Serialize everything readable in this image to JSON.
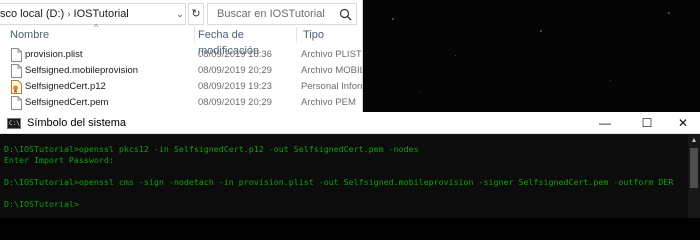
{
  "explorer": {
    "address": {
      "location": "sco local (D:)",
      "folder": "IOSTutorial"
    },
    "search_placeholder": "Buscar en IOSTutorial",
    "columns": {
      "name": "Nombre",
      "date": "Fecha de modificación",
      "type": "Tipo"
    },
    "files": [
      {
        "name": "provision.plist",
        "date": "08/09/2019 18:36",
        "type": "Archivo PLIST",
        "icon": "file-icon"
      },
      {
        "name": "Selfsigned.mobileprovision",
        "date": "08/09/2019 20:29",
        "type": "Archivo MOBILEPR",
        "icon": "file-icon"
      },
      {
        "name": "SelfsignedCert.p12",
        "date": "08/09/2019 19:23",
        "type": "Personal Informat",
        "icon": "certificate-icon"
      },
      {
        "name": "SelfsignedCert.pem",
        "date": "08/09/2019 20:29",
        "type": "Archivo PEM",
        "icon": "file-icon"
      }
    ]
  },
  "cmd": {
    "title": "Símbolo del sistema",
    "icon_text": "C:\\",
    "lines": [
      "D:\\IOSTutorial>openssl pkcs12 -in SelfsignedCert.p12 -out SelfsignedCert.pem -nodes",
      "Enter Import Password:",
      "",
      "D:\\IOSTutorial>openssl cms -sign -nodetach -in provision.plist -out Selfsigned.mobileprovision -signer SelfsignedCert.pem -outform DER",
      "",
      "D:\\IOSTutorial>"
    ],
    "text_color": "#13a10e",
    "buttons": {
      "minimize": "—",
      "maximize": "☐",
      "close": "✕"
    }
  },
  "icons": {
    "refresh": "↻",
    "dropdown": "⌄",
    "sort_caret": "^"
  }
}
